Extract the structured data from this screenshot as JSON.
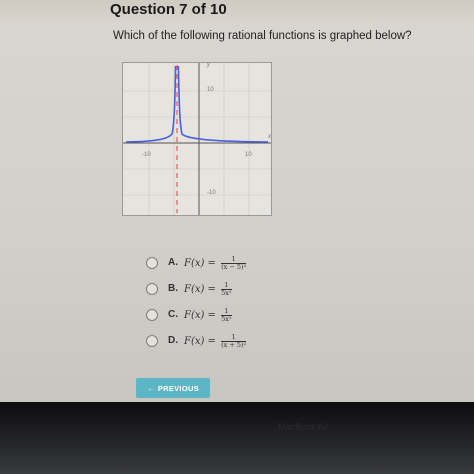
{
  "question": {
    "title": "Question 7 of 10",
    "text": "Which of the following rational functions is graphed below?"
  },
  "graph": {
    "x_axis_label": "x",
    "y_axis_label": "y",
    "ticks": {
      "x_neg": "-10",
      "x_pos": "10",
      "y_pos": "10",
      "y_neg": "-10"
    },
    "curve_color": "#4a63d6",
    "asymptote_color": "#d94545"
  },
  "options": [
    {
      "letter": "A.",
      "lhs": "F(x) =",
      "num": "1",
      "den": "(x − 5)²"
    },
    {
      "letter": "B.",
      "lhs": "F(x) =",
      "num": "1",
      "den": "5x²"
    },
    {
      "letter": "C.",
      "lhs": "F(x) =",
      "num": "1",
      "den": "5x²"
    },
    {
      "letter": "D.",
      "lhs": "F(x) =",
      "num": "1",
      "den": "(x + 5)²"
    }
  ],
  "nav": {
    "previous_label": "PREVIOUS",
    "previous_icon": "arrow-left-icon"
  },
  "bezel": {
    "text": "MacBook Air"
  }
}
